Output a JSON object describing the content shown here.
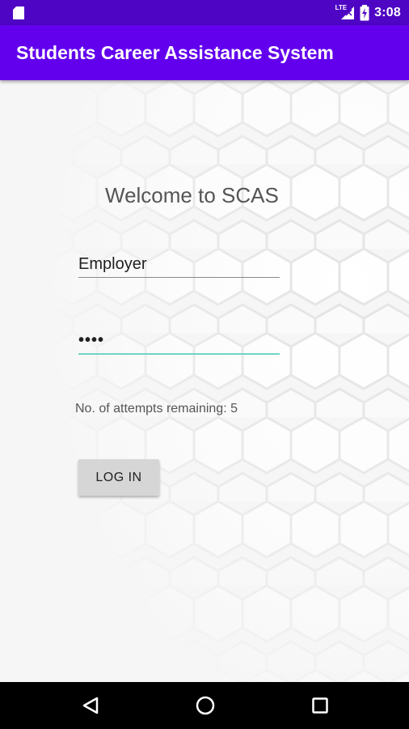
{
  "status_bar": {
    "network": "LTE",
    "time": "3:08",
    "icons": [
      "sd-card-icon",
      "signal-icon",
      "battery-icon"
    ]
  },
  "app_bar": {
    "title": "Students Career Assistance System"
  },
  "login": {
    "welcome": "Welcome to SCAS",
    "username_value": "Employer",
    "password_value": "1234",
    "attempts_text": "No. of attempts remaining: 5",
    "login_label": "LOG IN"
  },
  "nav_bar": {
    "icons": [
      "back-icon",
      "home-icon",
      "recents-icon"
    ]
  },
  "colors": {
    "status_bar": "#4e05c4",
    "app_bar": "#6200ee",
    "focus_underline": "#6fd6c6",
    "button": "#d6d6d6"
  }
}
